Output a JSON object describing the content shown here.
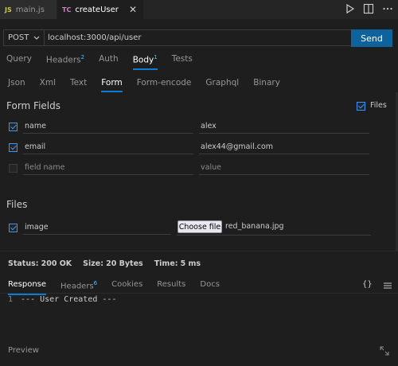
{
  "editor_tabs": [
    {
      "badge": "JS",
      "label": "main.js"
    },
    {
      "badge": "TC",
      "label": "createUser",
      "close": "✕"
    }
  ],
  "request": {
    "method": "POST",
    "url": "localhost:3000/api/user",
    "send_label": "Send"
  },
  "request_tabs": [
    {
      "label": "Query",
      "count": ""
    },
    {
      "label": "Headers",
      "count": "2"
    },
    {
      "label": "Auth",
      "count": ""
    },
    {
      "label": "Body",
      "count": "1"
    },
    {
      "label": "Tests",
      "count": ""
    }
  ],
  "body_tabs": [
    "Json",
    "Xml",
    "Text",
    "Form",
    "Form-encode",
    "Graphql",
    "Binary"
  ],
  "form_fields": {
    "title": "Form Fields",
    "files_toggle_label": "Files",
    "rows": [
      {
        "name": "name",
        "value": "alex",
        "checked": true
      },
      {
        "name": "email",
        "value": "alex44@gmail.com",
        "checked": true
      },
      {
        "name_placeholder": "field name",
        "value_placeholder": "value",
        "checked": false
      }
    ]
  },
  "files": {
    "title": "Files",
    "row": {
      "name": "image",
      "button_label": "Choose file",
      "file_name": "red_banana.jpg",
      "checked": true
    }
  },
  "response": {
    "status_label": "Status:",
    "status_value": "200 OK",
    "size_label": "Size:",
    "size_value": "20 Bytes",
    "time_label": "Time:",
    "time_value": "5 ms",
    "tabs": [
      {
        "label": "Response",
        "count": ""
      },
      {
        "label": "Headers",
        "count": "6"
      },
      {
        "label": "Cookies",
        "count": ""
      },
      {
        "label": "Results",
        "count": ""
      },
      {
        "label": "Docs",
        "count": ""
      }
    ],
    "line_number": "1",
    "body_line": "--- User Created ---",
    "format_glyph": "{}",
    "preview_label": "Preview"
  },
  "colors": {
    "accent": "#0e639c",
    "status_ok": "#4ec94e",
    "checkbox": "#3794ff"
  }
}
